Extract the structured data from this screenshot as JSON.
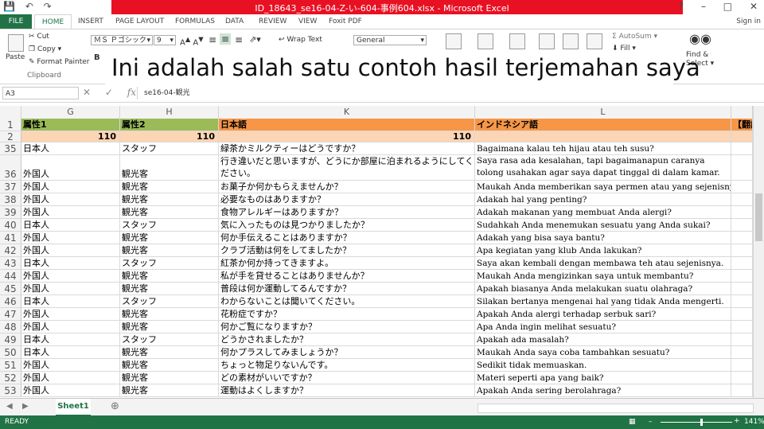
{
  "window": {
    "title": "ID_18643_se16-04-Z-い-604-事例604.xlsx - Microsoft Excel",
    "signin": "Sign in"
  },
  "tabs": [
    "FILE",
    "HOME",
    "INSERT",
    "PAGE LAYOUT",
    "FORMULAS",
    "DATA",
    "REVIEW",
    "VIEW",
    "Foxit PDF"
  ],
  "ribbon": {
    "paste": "Paste",
    "cut": "Cut",
    "copy": "Copy",
    "format_painter": "Format Painter",
    "clipboard": "Clipboard",
    "font_name": "ＭＳ Ｐゴシック",
    "font_size": "9",
    "wrap_text": "Wrap Text",
    "number_format": "General",
    "autosum": "AutoSum",
    "fill": "Fill",
    "find_select": "Find &",
    "find_select2": "Select"
  },
  "overlay_caption": "Ini adalah salah satu contoh hasil terjemahan saya",
  "formula_bar": {
    "name_box": "A3",
    "content": "se16-04-観光"
  },
  "columns": [
    "G",
    "H",
    "K",
    "L"
  ],
  "header_row": {
    "g": "属性1",
    "h": "属性2",
    "k": "日本語",
    "l": "インドネシア語",
    "m": "【翻訳"
  },
  "count_row": {
    "g": "110",
    "h": "110",
    "k": "110"
  },
  "rows": [
    {
      "n": "35",
      "g": "日本人",
      "h": "スタッフ",
      "k": "緑茶かミルクティーはどうですか？",
      "l": "Bagaimana kalau teh hijau atau teh susu?"
    },
    {
      "n": "36",
      "g": "外国人",
      "h": "観光客",
      "k": "行き違いだと思いますが、どうにか部屋に泊まれるようにしてください。",
      "l": "Saya rasa ada kesalahan, tapi bagaimanapun caranya tolong usahakan agar saya dapat tinggal di dalam kamar."
    },
    {
      "n": "37",
      "g": "外国人",
      "h": "観光客",
      "k": "お菓子か何かもらえませんか？",
      "l": "Maukah Anda memberikan saya permen atau yang sejenisnya?"
    },
    {
      "n": "38",
      "g": "外国人",
      "h": "観光客",
      "k": "必要なものはありますか？",
      "l": "Adakah hal yang penting?"
    },
    {
      "n": "39",
      "g": "外国人",
      "h": "観光客",
      "k": "食物アレルギーはありますか？",
      "l": "Adakah makanan yang membuat Anda alergi?"
    },
    {
      "n": "40",
      "g": "日本人",
      "h": "スタッフ",
      "k": "気に入ったものは見つかりましたか？",
      "l": "Sudahkah Anda menemukan sesuatu yang Anda sukai?"
    },
    {
      "n": "41",
      "g": "外国人",
      "h": "観光客",
      "k": "何か手伝えることはありますか？",
      "l": "Adakah yang bisa saya bantu?"
    },
    {
      "n": "42",
      "g": "外国人",
      "h": "観光客",
      "k": "クラブ活動は何をしてましたか？",
      "l": "Apa kegiatan yang klub Anda lakukan?"
    },
    {
      "n": "43",
      "g": "日本人",
      "h": "スタッフ",
      "k": "紅茶か何か持ってきますよ。",
      "l": "Saya akan kembali dengan membawa teh atau sejenisnya."
    },
    {
      "n": "44",
      "g": "外国人",
      "h": "観光客",
      "k": "私が手を貸せることはありませんか？",
      "l": "Maukah Anda mengizinkan saya untuk membantu?"
    },
    {
      "n": "45",
      "g": "外国人",
      "h": "観光客",
      "k": "普段は何か運動してるんですか？",
      "l": "Apakah biasanya Anda melakukan suatu olahraga?"
    },
    {
      "n": "46",
      "g": "日本人",
      "h": "スタッフ",
      "k": "わからないことは聞いてください。",
      "l": "Silakan bertanya mengenai hal yang tidak Anda mengerti."
    },
    {
      "n": "47",
      "g": "外国人",
      "h": "観光客",
      "k": "花粉症ですか？",
      "l": "Apakah Anda alergi terhadap serbuk sari?"
    },
    {
      "n": "48",
      "g": "外国人",
      "h": "観光客",
      "k": "何かご覧になりますか？",
      "l": "Apa Anda ingin melihat sesuatu?"
    },
    {
      "n": "49",
      "g": "日本人",
      "h": "スタッフ",
      "k": "どうかされましたか？",
      "l": "Apakah ada masalah?"
    },
    {
      "n": "50",
      "g": "日本人",
      "h": "観光客",
      "k": "何かプラスしてみましょうか？",
      "l": "Maukah Anda saya coba tambahkan sesuatu?"
    },
    {
      "n": "51",
      "g": "外国人",
      "h": "観光客",
      "k": "ちょっと物足りないんです。",
      "l": "Sedikit tidak memuaskan."
    },
    {
      "n": "52",
      "g": "外国人",
      "h": "観光客",
      "k": "どの素材がいいですか？",
      "l": "Materi seperti apa yang baik?"
    },
    {
      "n": "53",
      "g": "外国人",
      "h": "観光客",
      "k": "運動はよくしますか？",
      "l": "Apakah Anda sering berolahraga?"
    }
  ],
  "sheet_tab": "Sheet1",
  "status": {
    "left": "READY",
    "zoom": "141%"
  }
}
